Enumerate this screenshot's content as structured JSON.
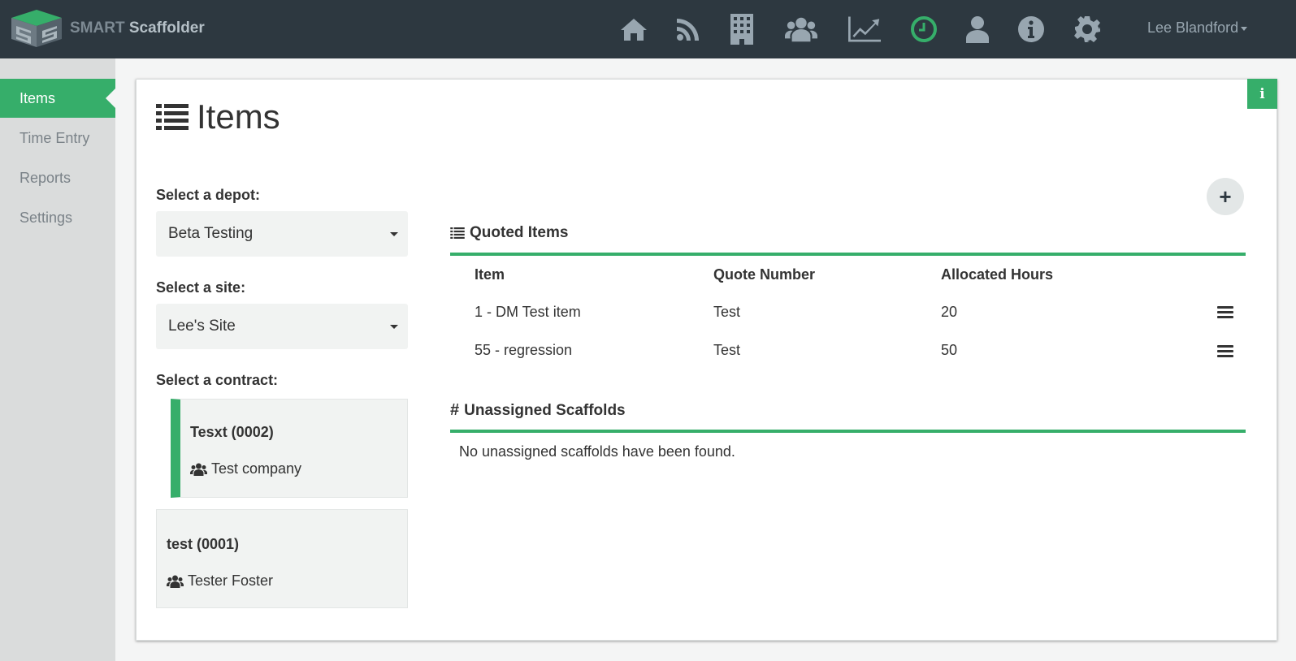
{
  "app": {
    "brand_part1": "SMART",
    "brand_part2": "Scaffolder",
    "user_name": "Lee Blandford",
    "accent_color": "#36ae6a",
    "nav_icons": [
      "home-icon",
      "rss-icon",
      "building-icon",
      "users-icon",
      "chart-icon",
      "clock-icon",
      "user-icon",
      "info-icon",
      "gear-icon"
    ],
    "active_nav_icon": "clock-icon"
  },
  "sidebar": {
    "items": [
      {
        "label": "Items",
        "active": true
      },
      {
        "label": "Time Entry",
        "active": false
      },
      {
        "label": "Reports",
        "active": false
      },
      {
        "label": "Settings",
        "active": false
      }
    ]
  },
  "page": {
    "title": "Items"
  },
  "filters": {
    "depot_label": "Select a depot:",
    "depot_value": "Beta Testing",
    "site_label": "Select a site:",
    "site_value": "Lee's Site",
    "contract_label": "Select a contract:",
    "contracts": [
      {
        "title": "Tesxt (0002)",
        "company": "Test company",
        "selected": true
      },
      {
        "title": "test (0001)",
        "company": "Tester Foster",
        "selected": false
      }
    ]
  },
  "quoted_items": {
    "heading": "Quoted Items",
    "columns": [
      "Item",
      "Quote Number",
      "Allocated Hours"
    ],
    "rows": [
      [
        "1 - DM Test item",
        "Test",
        "20"
      ],
      [
        "55 - regression",
        "Test",
        "50"
      ]
    ]
  },
  "unassigned": {
    "heading": "Unassigned Scaffolds",
    "empty_message": "No unassigned scaffolds have been found."
  }
}
